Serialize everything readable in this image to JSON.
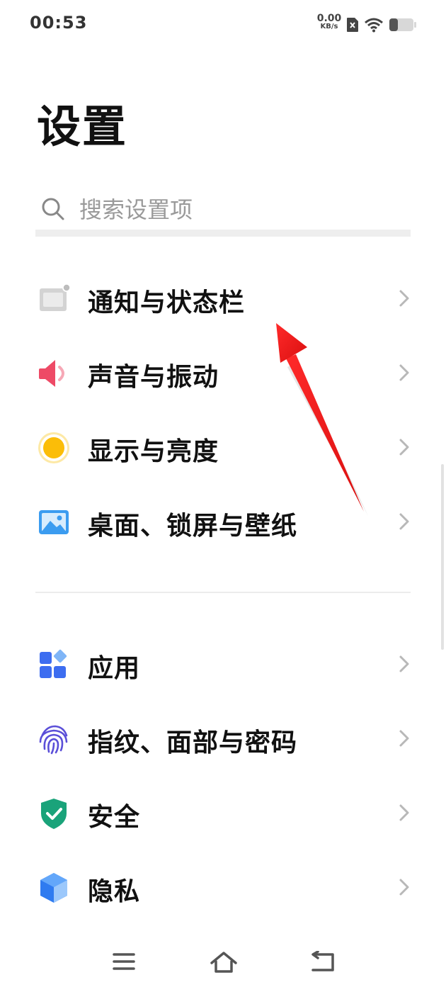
{
  "status_bar": {
    "time": "00:53",
    "net_speed_value": "0.00",
    "net_speed_unit": "KB/s",
    "icons": [
      "no-sim-icon",
      "wifi-icon",
      "battery-icon"
    ]
  },
  "page_title": "设置",
  "search": {
    "placeholder": "搜索设置项"
  },
  "groups": [
    {
      "items": [
        {
          "label": "通知与状态栏",
          "icon": "notification-icon"
        },
        {
          "label": "声音与振动",
          "icon": "speaker-icon"
        },
        {
          "label": "显示与亮度",
          "icon": "brightness-icon"
        },
        {
          "label": "桌面、锁屏与壁纸",
          "icon": "wallpaper-icon"
        }
      ]
    },
    {
      "items": [
        {
          "label": "应用",
          "icon": "apps-icon"
        },
        {
          "label": "指纹、面部与密码",
          "icon": "fingerprint-icon"
        },
        {
          "label": "安全",
          "icon": "shield-icon"
        },
        {
          "label": "隐私",
          "icon": "privacy-cube-icon"
        }
      ]
    }
  ],
  "nav_bar": {
    "icons": [
      "menu-icon",
      "home-icon",
      "back-icon"
    ]
  },
  "colors": {
    "accent_blue": "#3d7cf0",
    "sound_red": "#f0506e",
    "brightness_yellow": "#fbbd08",
    "shield_green": "#1aa37a",
    "annotation_arrow": "#ee1c1c"
  }
}
